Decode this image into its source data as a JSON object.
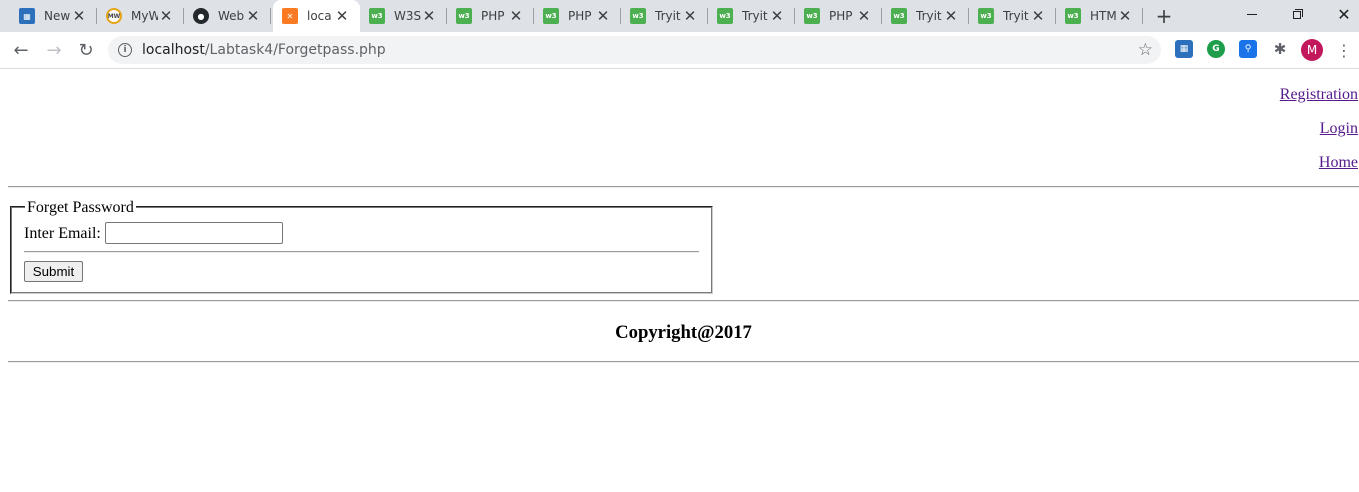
{
  "browser": {
    "tabs": [
      {
        "title": "New",
        "icon": "clapperboard-icon",
        "active": false
      },
      {
        "title": "MyW",
        "icon": "mw-icon",
        "active": false
      },
      {
        "title": "Web",
        "icon": "github-icon",
        "active": false
      },
      {
        "title": "loca",
        "icon": "xampp-icon",
        "active": true
      },
      {
        "title": "W3S",
        "icon": "w3schools-icon",
        "active": false
      },
      {
        "title": "PHP",
        "icon": "w3schools-icon",
        "active": false
      },
      {
        "title": "PHP",
        "icon": "w3schools-icon",
        "active": false
      },
      {
        "title": "Tryit",
        "icon": "w3schools-icon",
        "active": false
      },
      {
        "title": "Tryit",
        "icon": "w3schools-icon",
        "active": false
      },
      {
        "title": "PHP",
        "icon": "w3schools-icon",
        "active": false
      },
      {
        "title": "Tryit",
        "icon": "w3schools-icon",
        "active": false
      },
      {
        "title": "Tryit",
        "icon": "w3schools-icon",
        "active": false
      },
      {
        "title": "HTM",
        "icon": "w3schools-icon",
        "active": false
      }
    ],
    "url_host": "localhost",
    "url_path": "/Labtask4/Forgetpass.php",
    "profile_initial": "M"
  },
  "nav": {
    "registration": "Registration",
    "login": "Login",
    "home": "Home"
  },
  "form": {
    "legend": "Forget Password",
    "email_label": "Inter Email:",
    "email_value": "",
    "submit_label": "Submit"
  },
  "footer": {
    "copyright": "Copyright@2017"
  }
}
